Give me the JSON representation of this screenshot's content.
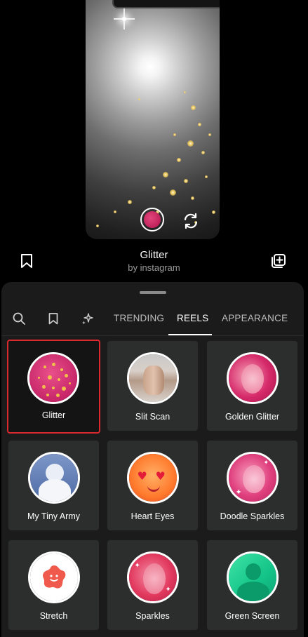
{
  "preview": {
    "shutter_icon": "effect-preview-icon",
    "flip_icon": "camera-flip-icon"
  },
  "effect": {
    "name": "Glitter",
    "author": "by instagram",
    "save_icon": "bookmark-icon",
    "add_icon": "add-to-collection-icon"
  },
  "tabs": {
    "search_icon": "search-icon",
    "saved_icon": "bookmark-icon",
    "sparkle_icon": "sparkles-icon",
    "items": [
      "TRENDING",
      "REELS",
      "APPEARANCE"
    ],
    "active": "REELS"
  },
  "effects": [
    {
      "label": "Glitter",
      "selected": true
    },
    {
      "label": "Slit Scan",
      "selected": false
    },
    {
      "label": "Golden Glitter",
      "selected": false
    },
    {
      "label": "My Tiny Army",
      "selected": false
    },
    {
      "label": "Heart Eyes",
      "selected": false
    },
    {
      "label": "Doodle Sparkles",
      "selected": false
    },
    {
      "label": "Stretch",
      "selected": false
    },
    {
      "label": "Sparkles",
      "selected": false
    },
    {
      "label": "Green Screen",
      "selected": false
    }
  ],
  "colors": {
    "selected_border": "#d9282e",
    "tile_bg": "#2c2d2d",
    "sheet_bg": "#1b1b1b"
  }
}
